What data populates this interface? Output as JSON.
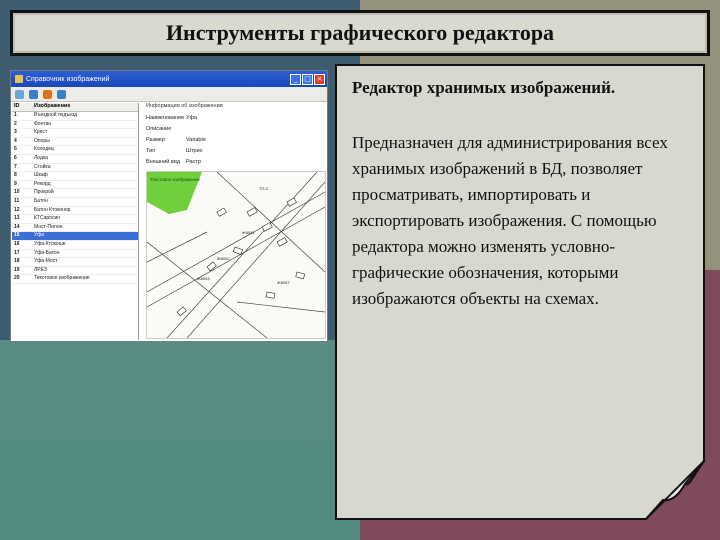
{
  "slide": {
    "title": "Инструменты графического редактора",
    "heading": "Редактор хранимых изображений.",
    "body": "Предназначен для администрирования всех хранимых изображений в БД, позволяет просматривать, импортировать и экспортировать изображения. С помощью редактора можно изменять условно-графические обозначения, которыми изображаются объекты на схемах."
  },
  "screenshot": {
    "window_title": "Справочник изображений",
    "columns": {
      "id": "ID",
      "name": "Изображение"
    },
    "rows": [
      {
        "id": "1",
        "name": "Въездной подъезд"
      },
      {
        "id": "2",
        "name": "Фонтан"
      },
      {
        "id": "3",
        "name": "Крест"
      },
      {
        "id": "4",
        "name": "Опоры"
      },
      {
        "id": "5",
        "name": "Колодец"
      },
      {
        "id": "6",
        "name": "Лодка"
      },
      {
        "id": "7",
        "name": "Стойка"
      },
      {
        "id": "8",
        "name": "Шкаф"
      },
      {
        "id": "9",
        "name": "Рекорд"
      },
      {
        "id": "10",
        "name": "Прокрой"
      },
      {
        "id": "11",
        "name": "Батон"
      },
      {
        "id": "12",
        "name": "Батон Ктоконор"
      },
      {
        "id": "13",
        "name": "КТСаросин"
      },
      {
        "id": "14",
        "name": "Мост-Пилон"
      },
      {
        "id": "15",
        "name": "Уфа"
      },
      {
        "id": "16",
        "name": "Уфа-Ктокоше"
      },
      {
        "id": "17",
        "name": "Уфа-Батон"
      },
      {
        "id": "18",
        "name": "Уфа-Мост"
      },
      {
        "id": "19",
        "name": "ЛРЕЗ"
      },
      {
        "id": "20",
        "name": "Текстовое изображение"
      }
    ],
    "selected_id": "15",
    "props": {
      "header": "Информация об изображении",
      "items": [
        {
          "label": "Наименование",
          "value": "Уфа"
        },
        {
          "label": "Описание",
          "value": ""
        },
        {
          "label": "Размер",
          "value": "Variable"
        },
        {
          "label": "Тип",
          "value": "Штрих"
        },
        {
          "label": "Внешний вид",
          "value": "Растр"
        }
      ]
    },
    "map": {
      "green_label": "Текстовое изображение",
      "labels": [
        "ТП-2",
        "Ж6051",
        "Ж6052",
        "Ж6053",
        "Ж6057"
      ]
    }
  }
}
